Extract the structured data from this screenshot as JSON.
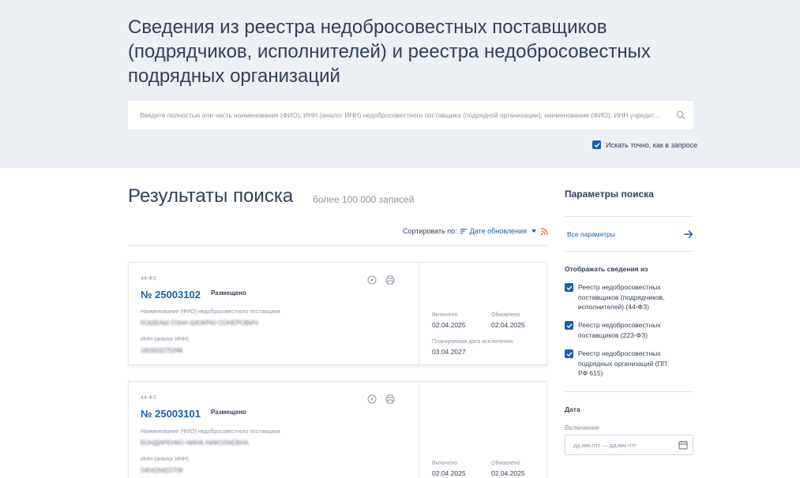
{
  "page": {
    "title": "Сведения из реестра недобросовестных поставщиков (подрядчиков, исполнителей) и реестра недобросовестных подрядных организаций"
  },
  "search": {
    "placeholder": "Введите полностью или часть наименования (ФИО), ИНН (аналог ИНН) недобросовестного поставщика (подрядной организации), наименование (ФИО), ИНН учредит...",
    "exact_label": "Искать точно, как в запросе",
    "exact_checked": true
  },
  "results": {
    "title": "Результаты поиска",
    "count": "более 100 000 записей",
    "sort_label": "Сортировать по:",
    "sort_value": "Дате обновления"
  },
  "cards": [
    {
      "law": "44-ФЗ",
      "number": "№ 25003102",
      "status": "Размещено",
      "name_label": "Наименование (ФИО) недобросовестного поставщика",
      "name_value": "КОШБАШ ОЗАН ШЮКРЮ СОНЕРОВИЧ",
      "inn_label": "ИНН (аналог ИНН)",
      "inn_value": "181603275346",
      "included_label": "Включено",
      "included_value": "02.04.2025",
      "updated_label": "Обновлено",
      "updated_value": "02.04.2025",
      "exclusion_label": "Планируемая дата исключения",
      "exclusion_value": "03.04.2027"
    },
    {
      "law": "44-ФЗ",
      "number": "№ 25003101",
      "status": "Размещено",
      "name_label": "Наименование (ФИО) недобросовестного поставщика",
      "name_value": "БОНДАРЕНКО НИНА НИКОЛАЕВНА",
      "inn_label": "ИНН (аналог ИНН)",
      "inn_value": "540426422709",
      "included_label": "Включено",
      "included_value": "02.04.2025",
      "updated_label": "Обновлено",
      "updated_value": "02.04.2025"
    }
  ],
  "sidebar": {
    "title": "Параметры поиска",
    "all_params": "Все параметры",
    "show_title": "Отображать сведения из",
    "registries": [
      {
        "label": "Реестр недобросовестных поставщиков (подрядчиков, исполнителей) (44-ФЗ)",
        "checked": true
      },
      {
        "label": "Реестр недобросовестных поставщиков (223-ФЗ)",
        "checked": true
      },
      {
        "label": "Реестр недобросовестных подрядных организаций (ПП РФ 615)",
        "checked": true
      }
    ],
    "date_title": "Дата",
    "inclusion_label": "Включение",
    "date_placeholder": "дд.мм.гггг — дд.мм.гггг"
  },
  "colors": {
    "accent": "#1a5fa8",
    "text": "#334059",
    "muted": "#8a94a6",
    "hero_bg": "#eceff3",
    "rss": "#e8663d"
  }
}
